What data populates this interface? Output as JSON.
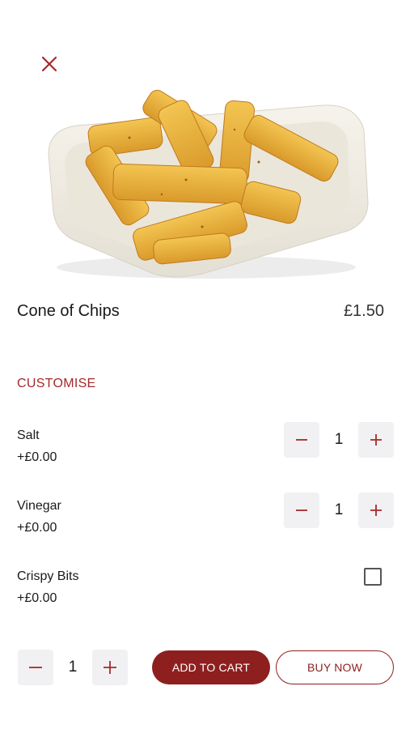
{
  "product": {
    "title": "Cone of Chips",
    "price": "£1.50",
    "image_subject": "chips in tray"
  },
  "customise": {
    "heading": "CUSTOMISE",
    "options": [
      {
        "name": "Salt",
        "price": "+£0.00",
        "control": "stepper",
        "quantity": "1"
      },
      {
        "name": "Vinegar",
        "price": "+£0.00",
        "control": "stepper",
        "quantity": "1"
      },
      {
        "name": "Crispy Bits",
        "price": "+£0.00",
        "control": "checkbox",
        "checked": false
      }
    ]
  },
  "footer": {
    "quantity": "1",
    "add_to_cart_label": "ADD TO CART",
    "buy_now_label": "BUY NOW"
  },
  "icons": {
    "close": "close-icon",
    "minus": "minus-icon",
    "plus": "plus-icon"
  },
  "colors": {
    "accent": "#a52a2a",
    "primary_button": "#8e1f1f",
    "stepper_bg": "#f1f1f3"
  }
}
